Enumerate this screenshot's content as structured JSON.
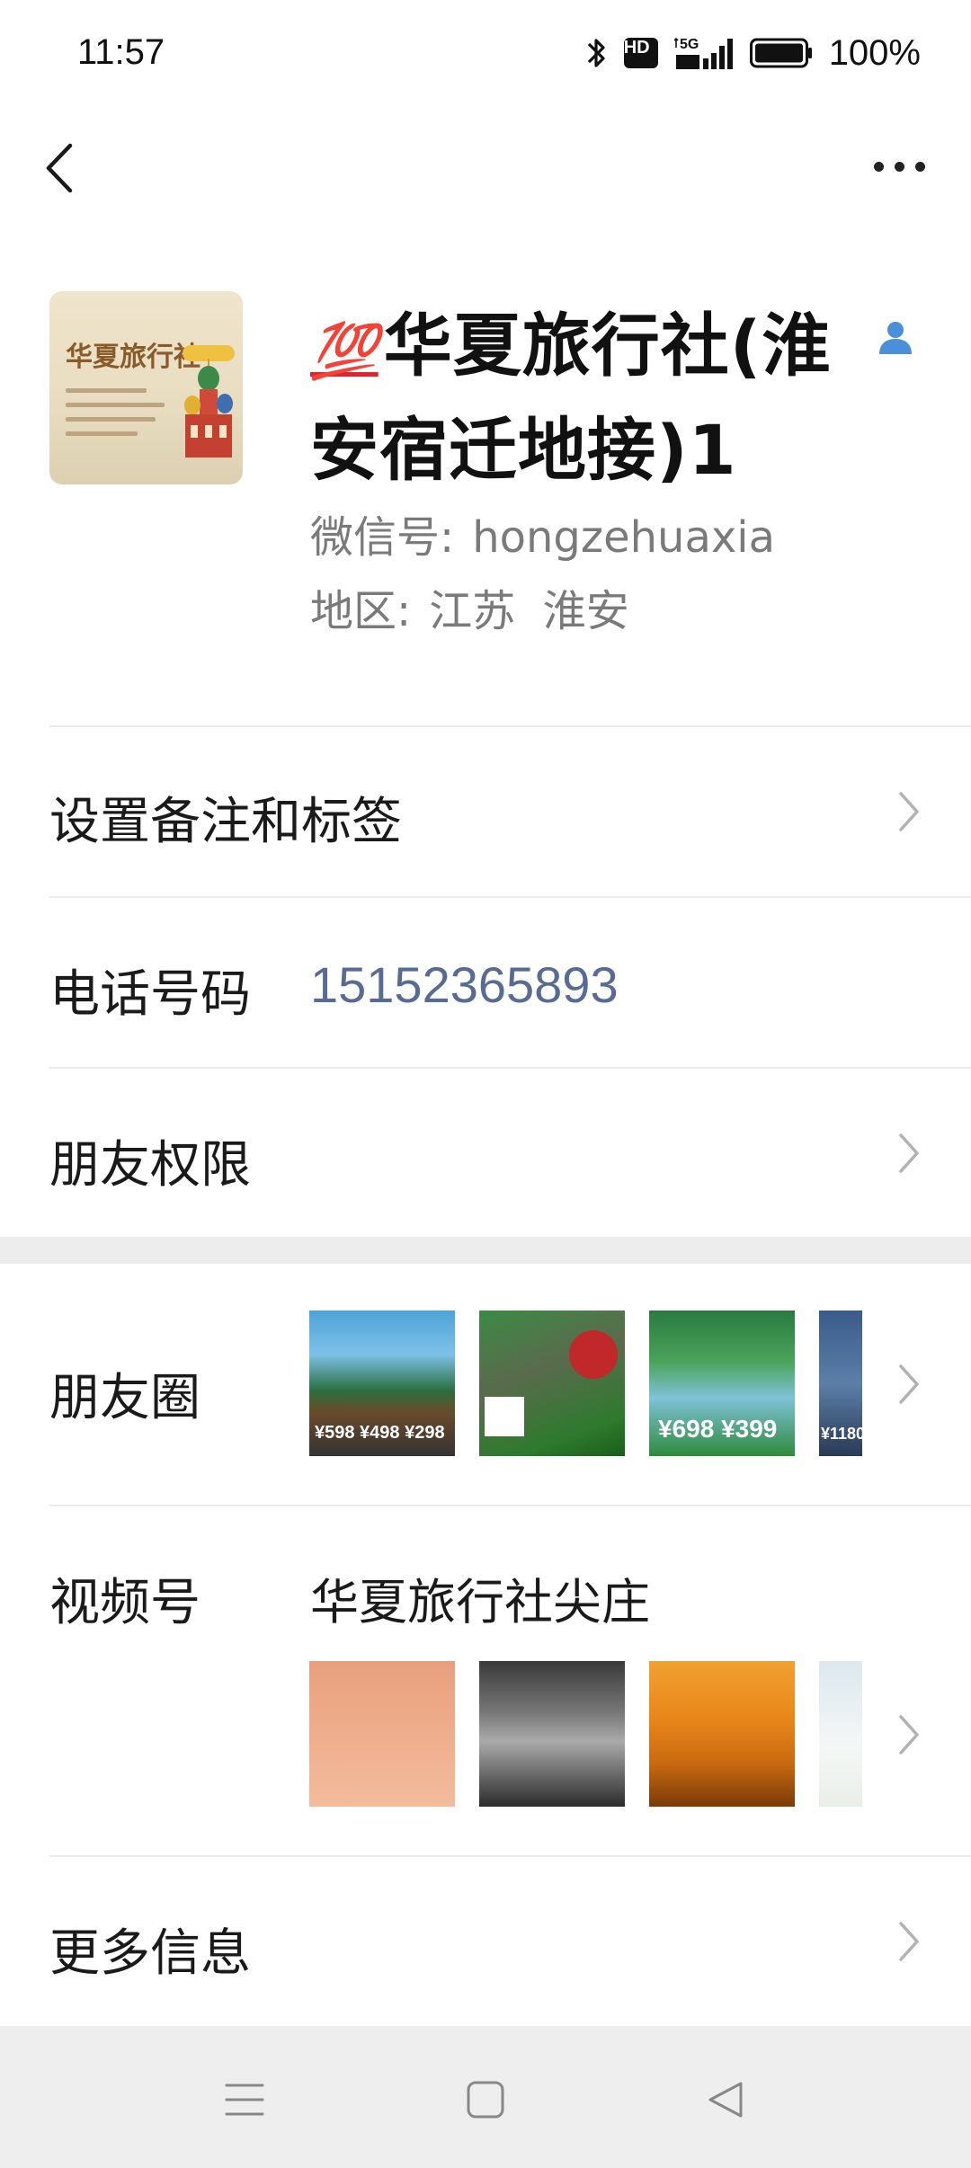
{
  "status_bar": {
    "time": "11:57",
    "hd_label": "HD",
    "network": "5G",
    "battery_text": "100%"
  },
  "profile": {
    "name_emoji": "💯",
    "name_line1": "华夏旅行社(淮",
    "name_line2": "安宿迁地接)1",
    "wechat_label": "微信号:",
    "wechat_id": "hongzehuaxia",
    "region_label": "地区:",
    "region_value": "江苏  淮安",
    "avatar_title": "华夏旅行社"
  },
  "rows": {
    "remark_label": "设置备注和标签",
    "phone_label": "电话号码",
    "phone_value": "15152365893",
    "permission_label": "朋友权限",
    "moments_label": "朋友圈",
    "channels_label": "视频号",
    "channels_name": "华夏旅行社尖庄",
    "more_label": "更多信息"
  },
  "moments_thumbs": {
    "t1_prices": "¥598 ¥498 ¥298",
    "t3_prices": "¥698 ¥399",
    "t4_price": "¥1180"
  },
  "colors": {
    "link": "#576b95",
    "accent_red": "#e0232e",
    "person_icon": "#4a90d9"
  },
  "icons": {
    "back": "chevron-left-icon",
    "more": "more-dots-icon",
    "chevron": "chevron-right-icon",
    "nav_menu": "menu-icon",
    "nav_home": "home-square-icon",
    "nav_back": "back-triangle-icon"
  }
}
